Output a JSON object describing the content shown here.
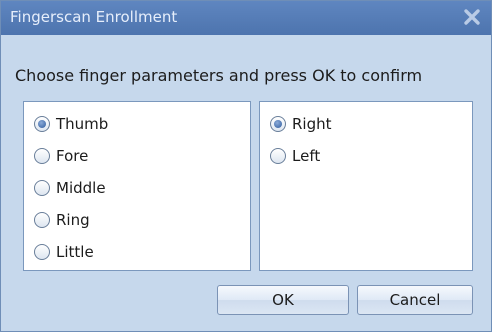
{
  "window": {
    "title": "Fingerscan Enrollment",
    "close_icon": "close-icon"
  },
  "instruction": "Choose finger parameters and press OK to confirm",
  "fingers": {
    "options": [
      {
        "label": "Thumb",
        "checked": true
      },
      {
        "label": "Fore",
        "checked": false
      },
      {
        "label": "Middle",
        "checked": false
      },
      {
        "label": "Ring",
        "checked": false
      },
      {
        "label": "Little",
        "checked": false
      }
    ]
  },
  "hands": {
    "options": [
      {
        "label": "Right",
        "checked": true
      },
      {
        "label": "Left",
        "checked": false
      }
    ]
  },
  "buttons": {
    "ok_label": "OK",
    "cancel_label": "Cancel"
  },
  "colors": {
    "titlebar": "#4d74ae",
    "window_bg": "#c6d8ec",
    "panel_border": "#7b98bd"
  }
}
